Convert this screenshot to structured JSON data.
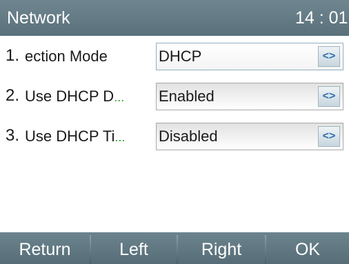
{
  "header": {
    "title": "Network",
    "clock": "14 : 01"
  },
  "rows": [
    {
      "number": "1.",
      "label": "ection Mode",
      "truncated": false,
      "value": "DHCP",
      "selected": true,
      "switch_icon": "left-right-arrows-icon"
    },
    {
      "number": "2.",
      "label": "Use DHCP D",
      "truncated": true,
      "value": "Enabled",
      "selected": false,
      "switch_icon": "left-right-arrows-icon"
    },
    {
      "number": "3.",
      "label": "Use DHCP Ti",
      "truncated": true,
      "value": "Disabled",
      "selected": false,
      "switch_icon": "left-right-arrows-icon"
    }
  ],
  "ellipsis": "...",
  "switch_glyph": "<>",
  "softkeys": [
    "Return",
    "Left",
    "Right",
    "OK"
  ],
  "colors": {
    "bar": "#5f7781",
    "ellipsis": "#2fa02f",
    "switch_arrows": "#2b6fb3"
  }
}
